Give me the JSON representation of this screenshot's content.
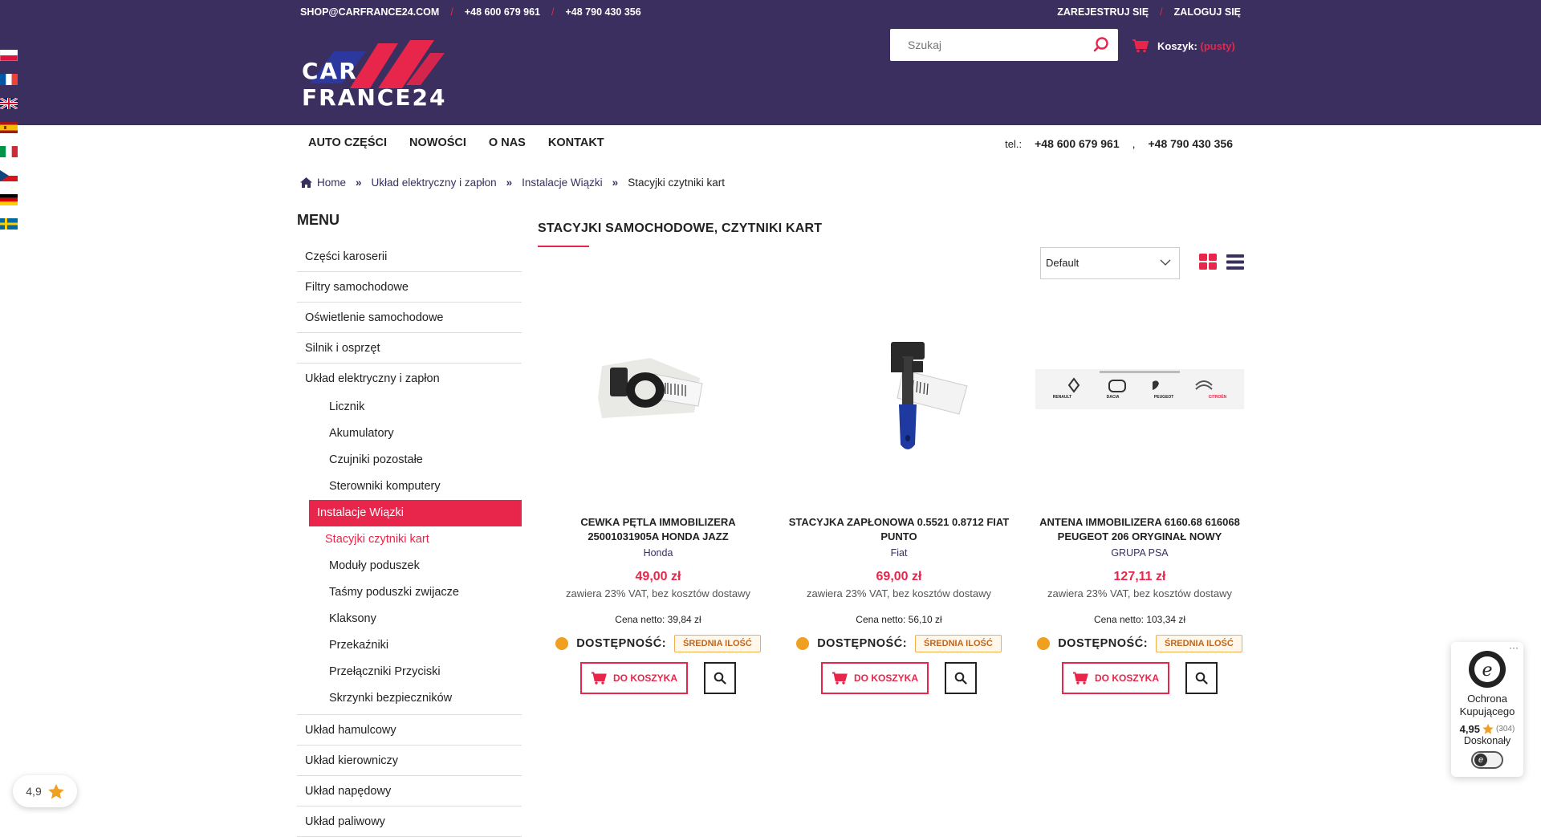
{
  "header": {
    "email": "SHOP@CARFRANCE24.COM",
    "phone1": "+48 600 679 961",
    "phone2": "+48 790 430 356",
    "register": "ZAREJESTRUJ SIĘ",
    "login": "ZALOGUJ SIĘ",
    "logo_text": "CAR FRANCE24",
    "search_placeholder": "Szukaj",
    "cart_label": "Koszyk:",
    "cart_status": "(pusty)"
  },
  "flags": [
    "flag-pl-icon",
    "flag-fr-icon",
    "flag-uk-icon",
    "flag-es-icon",
    "flag-it-icon",
    "flag-cz-icon",
    "flag-de-icon",
    "flag-se-icon"
  ],
  "nav": {
    "items": [
      "AUTO CZĘŚCI",
      "NOWOŚCI",
      "O NAS",
      "KONTAKT"
    ],
    "tel_label": "tel.:",
    "tel1": "+48 600 679 961",
    "tel_sep": ",",
    "tel2": "+48 790 430 356"
  },
  "breadcrumb": {
    "home": "Home",
    "level1": "Układ elektryczny i zapłon",
    "level2": "Instalacje Wiązki",
    "current": "Stacyjki czytniki kart",
    "sep": "»"
  },
  "sidebar": {
    "title": "MENU",
    "top_items": [
      "Części karoserii",
      "Filtry samochodowe",
      "Oświetlenie samochodowe",
      "Silnik i osprzęt"
    ],
    "open_item": "Układ elektryczny i zapłon",
    "sub_items_before": [
      "Licznik",
      "Akumulatory",
      "Czujniki pozostałe",
      "Sterowniki komputery"
    ],
    "active_sub": "Instalacje Wiązki",
    "active_subsub": "Stacyjki czytniki kart",
    "sub_items_after": [
      "Moduły poduszek",
      "Taśmy poduszki zwijacze",
      "Klaksony",
      "Przekaźniki",
      "Przełączniki Przyciski",
      "Skrzynki bezpieczników"
    ],
    "bottom_items": [
      "Układ hamulcowy",
      "Układ kierowniczy",
      "Układ napędowy",
      "Układ paliwowy"
    ]
  },
  "content": {
    "title": "STACYJKI SAMOCHODOWE, CZYTNIKI KART",
    "sort_value": "Default"
  },
  "products": [
    {
      "name": "CEWKA PĘTLA IMMOBILIZERA 25001031905A HONDA JAZZ",
      "brand": "Honda",
      "price": "49,00 zł",
      "vat": "zawiera 23% VAT, bez kosztów dostawy",
      "net": "Cena netto: 39,84 zł",
      "availability_label": "DOSTĘPNOŚĆ:",
      "availability": "ŚREDNIA ILOŚĆ",
      "cart_button": "DO KOSZYKA"
    },
    {
      "name": "STACYJKA ZAPŁONOWA 0.5521 0.8712 FIAT PUNTO",
      "brand": "Fiat",
      "price": "69,00 zł",
      "vat": "zawiera 23% VAT, bez kosztów dostawy",
      "net": "Cena netto: 56,10 zł",
      "availability_label": "DOSTĘPNOŚĆ:",
      "availability": "ŚREDNIA ILOŚĆ",
      "cart_button": "DO KOSZYKA"
    },
    {
      "name": "ANTENA IMMOBILIZERA 6160.68 616068 PEUGEOT 206 ORYGINAŁ NOWY",
      "brand": "GRUPA PSA",
      "price": "127,11 zł",
      "vat": "zawiera 23% VAT, bez kosztów dostawy",
      "net": "Cena netto: 103,34 zł",
      "availability_label": "DOSTĘPNOŚĆ:",
      "availability": "ŚREDNIA ILOŚĆ",
      "cart_button": "DO KOSZYKA"
    }
  ],
  "product3_brand_logos": [
    "RENAULT",
    "DACIA",
    "PEUGEOT",
    "CITROËN"
  ],
  "rating_widget": {
    "score": "4,9"
  },
  "trusted_shops": {
    "more": "···",
    "label": "Ochrona Kupującego",
    "score": "4,95",
    "count": "(304)",
    "rating": "Doskonały"
  },
  "colors": {
    "header_bg": "#3a2f5f",
    "accent": "#e8254a",
    "availability_dot": "#f0a020"
  }
}
